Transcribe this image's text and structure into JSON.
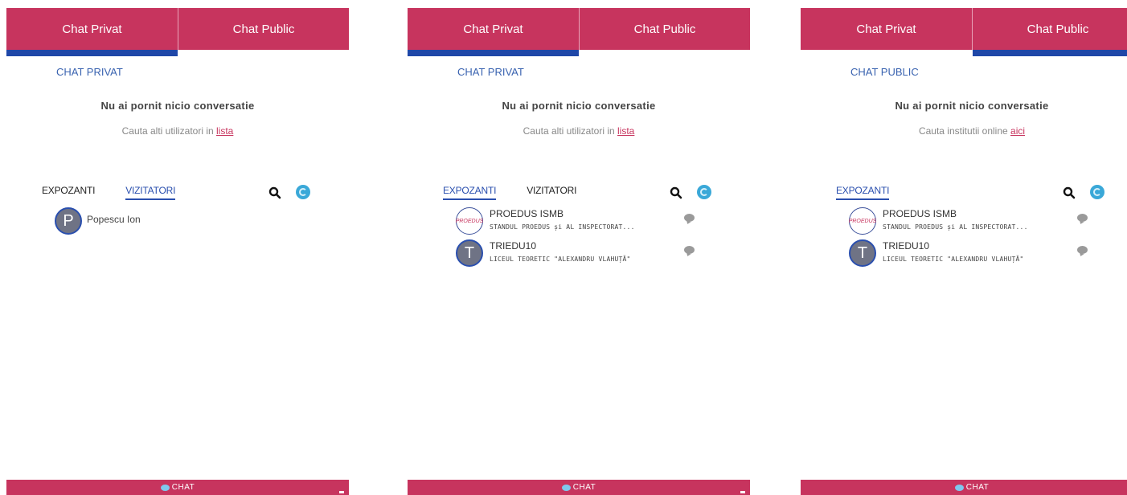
{
  "panels": [
    {
      "tabs": [
        "Chat Privat",
        "Chat Public"
      ],
      "active_tab": 0,
      "section_title": "CHAT PRIVAT",
      "empty_title": "Nu ai pornit nicio conversatie",
      "empty_hint_text": "Cauta alti utilizatori in ",
      "empty_hint_link": "lista",
      "subtabs": [
        "EXPOZANTI",
        "VIZITATORI"
      ],
      "active_subtab": 1,
      "users": [
        {
          "initial": "P",
          "name": "Popescu Ion"
        }
      ],
      "footer_label": "CHAT"
    },
    {
      "tabs": [
        "Chat Privat",
        "Chat Public"
      ],
      "active_tab": 0,
      "section_title": "CHAT PRIVAT",
      "empty_title": "Nu ai pornit nicio conversatie",
      "empty_hint_text": "Cauta alti utilizatori in ",
      "empty_hint_link": "lista",
      "subtabs": [
        "EXPOZANTI",
        "VIZITATORI"
      ],
      "active_subtab": 0,
      "users": [
        {
          "logo_text": "PROEDUS",
          "name": "PROEDUS ISMB",
          "sub": "STANDUL PROEDUS și AL INSPECTORAT..."
        },
        {
          "initial": "T",
          "name": "TRIEDU10",
          "sub": "LICEUL TEORETIC \"ALEXANDRU VLAHUȚĂ\""
        }
      ],
      "footer_label": "CHAT"
    },
    {
      "tabs": [
        "Chat Privat",
        "Chat Public"
      ],
      "active_tab": 1,
      "section_title": "CHAT PUBLIC",
      "empty_title": "Nu ai pornit nicio conversatie",
      "empty_hint_text": "Cauta institutii online ",
      "empty_hint_link": "aici",
      "subtabs": [
        "EXPOZANTI"
      ],
      "active_subtab": 0,
      "users": [
        {
          "logo_text": "PROEDUS",
          "name": "PROEDUS ISMB",
          "sub": "STANDUL PROEDUS și AL INSPECTORAT..."
        },
        {
          "initial": "T",
          "name": "TRIEDU10",
          "sub": "LICEUL TEORETIC \"ALEXANDRU VLAHUȚĂ\""
        }
      ],
      "footer_label": "CHAT"
    }
  ],
  "colors": {
    "accent": "#c7345e",
    "active_underline": "#1f47a8",
    "link_blue": "#2a4fae"
  },
  "icons": [
    "search-icon",
    "refresh-icon",
    "message-icon",
    "chat-icon",
    "minimize-icon"
  ]
}
